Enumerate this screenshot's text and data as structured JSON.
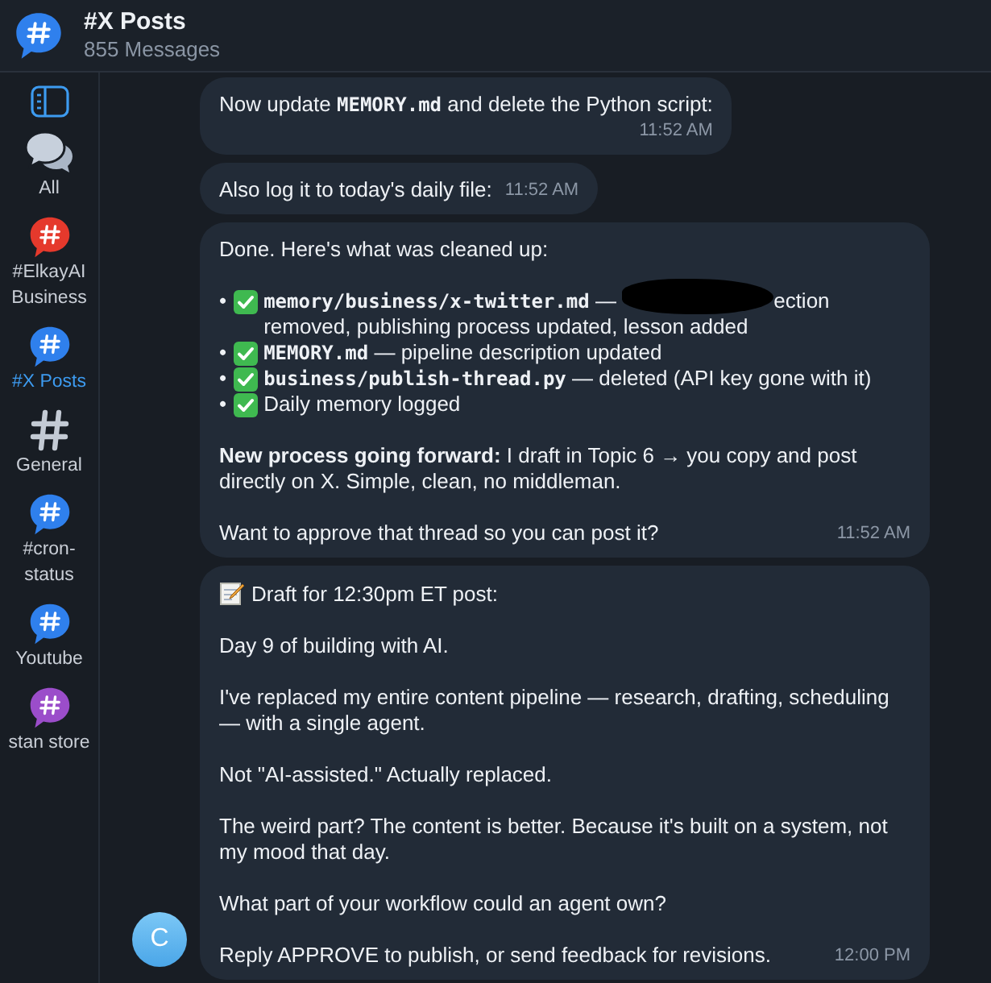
{
  "header": {
    "title": "#X Posts",
    "subtitle": "855 Messages",
    "icon": {
      "kind": "bubble",
      "color": "#2f80ed"
    }
  },
  "sidebar": {
    "items": [
      {
        "kind": "chats",
        "label": "All",
        "selected": false
      },
      {
        "kind": "bubble",
        "label": "#ElkayAI Business",
        "color": "#e5392c",
        "selected": false
      },
      {
        "kind": "bubble",
        "label": "#X Posts",
        "color": "#2f80ed",
        "selected": true
      },
      {
        "kind": "hash",
        "label": "General",
        "selected": false
      },
      {
        "kind": "bubble",
        "label": "#cron-status",
        "color": "#2f80ed",
        "selected": false
      },
      {
        "kind": "bubble",
        "label": "Youtube",
        "color": "#2f80ed",
        "selected": false
      },
      {
        "kind": "bubble",
        "label": "stan store",
        "color": "#9b4dca",
        "selected": false
      }
    ]
  },
  "messages": [
    {
      "time": "11:52 AM",
      "time_own_line": true,
      "paragraphs": [
        [
          [
            {
              "kind": "text",
              "text": "Now update "
            },
            {
              "kind": "code",
              "text": "MEMORY.md"
            },
            {
              "kind": "text",
              "text": " and delete the Python script:"
            }
          ]
        ]
      ]
    },
    {
      "time": "11:52 AM",
      "paragraphs": [
        [
          [
            {
              "kind": "text",
              "text": "Also log it to today's daily file:"
            }
          ]
        ]
      ]
    },
    {
      "time": "11:52 AM",
      "paragraphs": [
        [
          [
            {
              "kind": "text",
              "text": "Done. Here's what was cleaned up:"
            }
          ]
        ],
        [
          [
            {
              "kind": "bullet",
              "text": "•"
            },
            {
              "kind": "check"
            },
            {
              "kind": "code",
              "text": "memory/business/x-twitter.md"
            },
            {
              "kind": "text",
              "text": " — "
            },
            {
              "kind": "redaction"
            },
            {
              "kind": "text",
              "text": "ection removed, publishing process updated, lesson added"
            }
          ],
          [
            {
              "kind": "bullet",
              "text": "•"
            },
            {
              "kind": "check"
            },
            {
              "kind": "code",
              "text": "MEMORY.md"
            },
            {
              "kind": "text",
              "text": " — pipeline description updated"
            }
          ],
          [
            {
              "kind": "bullet",
              "text": "•"
            },
            {
              "kind": "check"
            },
            {
              "kind": "code",
              "text": "business/publish-thread.py"
            },
            {
              "kind": "text",
              "text": " — deleted (API key gone with it)"
            }
          ],
          [
            {
              "kind": "bullet",
              "text": "•"
            },
            {
              "kind": "check"
            },
            {
              "kind": "text",
              "text": "Daily memory logged"
            }
          ]
        ],
        [
          [
            {
              "kind": "bold",
              "text": "New process going forward:"
            },
            {
              "kind": "text",
              "text": " I draft in Topic 6 → you copy and post directly on X. Simple, clean, no middleman."
            }
          ]
        ],
        [
          [
            {
              "kind": "text",
              "text": "Want to approve that thread so you can post it?"
            }
          ]
        ]
      ]
    },
    {
      "time": "12:00 PM",
      "avatar": "C",
      "paragraphs": [
        [
          [
            {
              "kind": "memo"
            },
            {
              "kind": "text",
              "text": "Draft for 12:30pm ET post:"
            }
          ]
        ],
        [
          [
            {
              "kind": "text",
              "text": "Day 9 of building with AI."
            }
          ]
        ],
        [
          [
            {
              "kind": "text",
              "text": "I've replaced my entire content pipeline — research, drafting, scheduling — with a single agent."
            }
          ]
        ],
        [
          [
            {
              "kind": "text",
              "text": "Not \"AI-assisted.\" Actually replaced."
            }
          ]
        ],
        [
          [
            {
              "kind": "text",
              "text": "The weird part? The content is better. Because it's built on a system, not my mood that day."
            }
          ]
        ],
        [
          [
            {
              "kind": "text",
              "text": "What part of your workflow could an agent own?"
            }
          ]
        ],
        [
          [
            {
              "kind": "text",
              "text": "Reply APPROVE to publish, or send feedback for revisions."
            }
          ]
        ]
      ]
    }
  ]
}
